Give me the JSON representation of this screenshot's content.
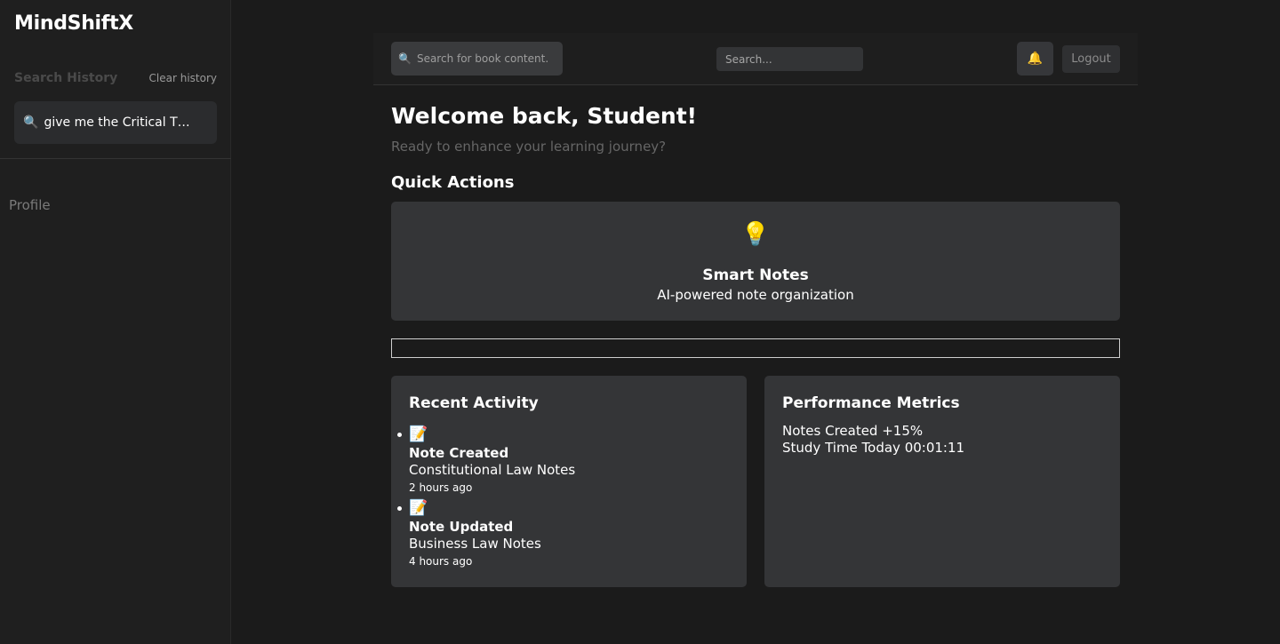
{
  "sidebar": {
    "brand": "MindShiftX",
    "search_history_title": "Search History",
    "clear_history_label": "Clear history",
    "history_items": [
      {
        "icon": "search-icon",
        "text": "give me the Critical Th..."
      }
    ],
    "profile_label": "Profile"
  },
  "header": {
    "book_search_placeholder": "Search for book content.",
    "search_placeholder": "Search...",
    "notification_icon": "bell-icon",
    "logout_label": "Logout"
  },
  "main": {
    "welcome": "Welcome back, Student!",
    "subtitle": "Ready to enhance your learning journey?",
    "quick_actions_title": "Quick Actions",
    "quick_actions": [
      {
        "icon": "lightbulb-icon",
        "title": "Smart Notes",
        "description": "AI-powered note organization"
      }
    ],
    "recent_activity": {
      "title": "Recent Activity",
      "items": [
        {
          "icon": "memo-icon",
          "title": "Note Created",
          "document": "Constitutional Law Notes",
          "time": "2 hours ago"
        },
        {
          "icon": "memo-icon",
          "title": "Note Updated",
          "document": "Business Law Notes",
          "time": "4 hours ago"
        }
      ]
    },
    "performance_metrics": {
      "title": "Performance Metrics",
      "lines": [
        "Notes Created +15%",
        "Study Time Today 00:01:11"
      ]
    }
  },
  "colors": {
    "background": "#1b1b1b",
    "sidebar": "#1f1f1f",
    "card": "#343537",
    "muted_text": "#666666"
  }
}
